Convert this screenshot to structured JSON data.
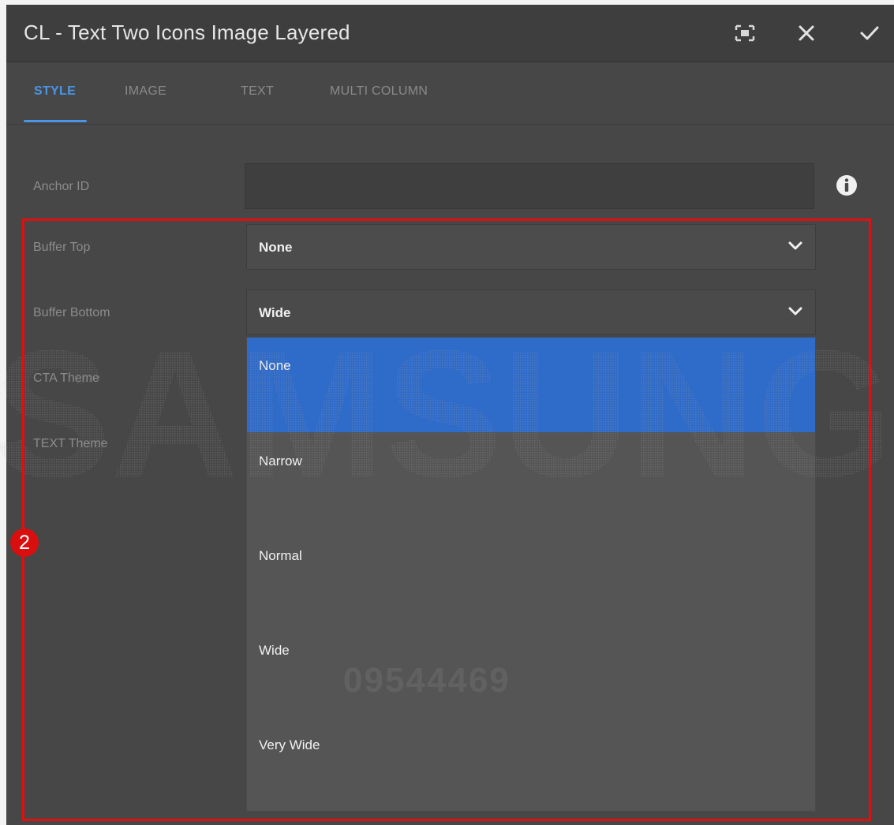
{
  "dialog": {
    "title": "CL - Text Two Icons Image Layered",
    "icons": [
      "fullscreen-icon",
      "close-icon",
      "checkmark-icon"
    ]
  },
  "tabs": [
    {
      "label": "STYLE",
      "active": true
    },
    {
      "label": "IMAGE",
      "active": false
    },
    {
      "label": "TEXT",
      "active": false
    },
    {
      "label": "MULTI COLUMN",
      "active": false
    }
  ],
  "form": {
    "anchor_id": {
      "label": "Anchor ID",
      "value": ""
    },
    "buffer_top": {
      "label": "Buffer Top",
      "value": "None"
    },
    "buffer_bottom": {
      "label": "Buffer Bottom",
      "value": "Wide"
    },
    "cta_theme": {
      "label": "CTA Theme"
    },
    "text_theme": {
      "label": "TEXT Theme"
    }
  },
  "dropdown": {
    "options": [
      "None",
      "Narrow",
      "Normal",
      "Wide",
      "Very Wide"
    ],
    "highlighted": "None"
  },
  "overlay": {
    "watermark": "SAMSUNG",
    "watermark_number": "09544469",
    "badge": "2"
  },
  "colors": {
    "accent": "#4a95e6",
    "highlight": "#2f6bc9",
    "annotation_red": "#e01010"
  }
}
